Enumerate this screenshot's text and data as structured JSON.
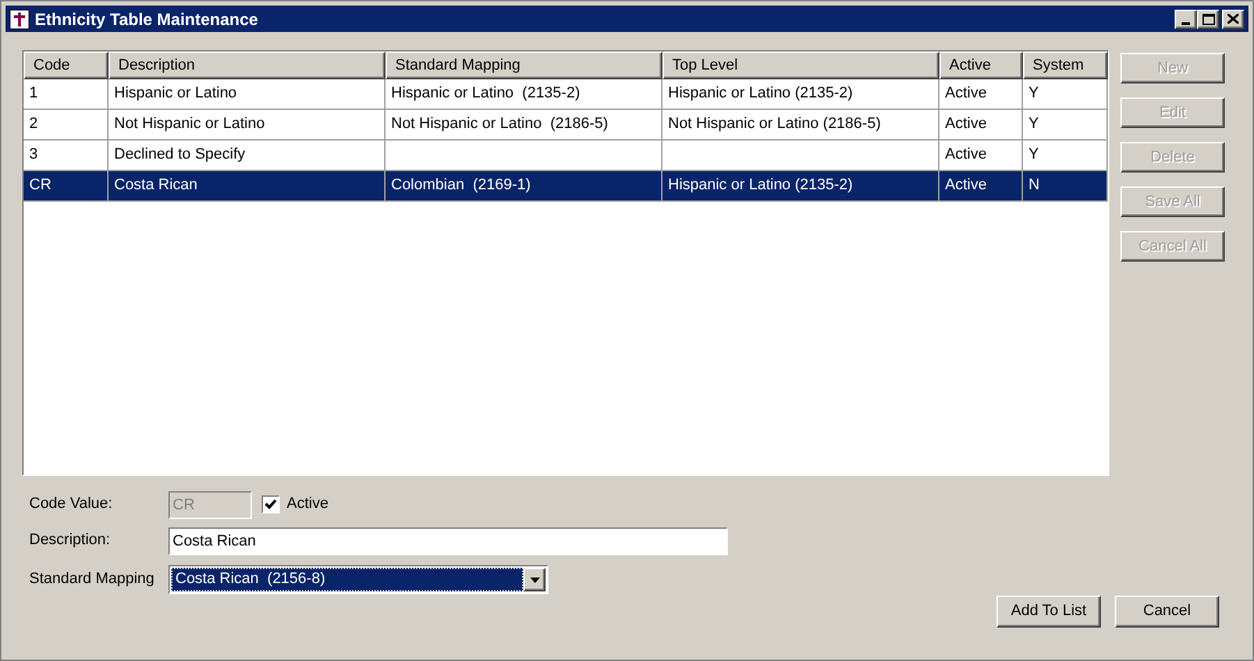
{
  "window": {
    "title": "Ethnicity Table Maintenance"
  },
  "table": {
    "columns": [
      "Code",
      "Description",
      "Standard Mapping",
      "Top Level",
      "Active",
      "System"
    ],
    "rows": [
      {
        "cells": [
          "1",
          "Hispanic or Latino",
          "Hispanic or Latino  (2135-2)",
          "Hispanic or Latino (2135-2)",
          "Active",
          "Y"
        ],
        "selected": false
      },
      {
        "cells": [
          "2",
          "Not Hispanic or Latino",
          "Not Hispanic or Latino  (2186-5)",
          "Not Hispanic or Latino (2186-5)",
          "Active",
          "Y"
        ],
        "selected": false
      },
      {
        "cells": [
          "3",
          "Declined to Specify",
          "",
          "",
          "Active",
          "Y"
        ],
        "selected": false
      },
      {
        "cells": [
          "CR",
          "Costa Rican",
          "Colombian  (2169-1)",
          "Hispanic or Latino (2135-2)",
          "Active",
          "N"
        ],
        "selected": true
      }
    ]
  },
  "side_buttons": [
    {
      "label": "New",
      "disabled": true
    },
    {
      "label": "Edit",
      "disabled": true
    },
    {
      "label": "Delete",
      "disabled": true
    },
    {
      "label": "Save All",
      "disabled": true
    },
    {
      "label": "Cancel All",
      "disabled": true
    }
  ],
  "form": {
    "code_value": {
      "label": "Code Value:",
      "value": "CR",
      "disabled": true
    },
    "active": {
      "label": "Active",
      "checked": true
    },
    "description": {
      "label": "Description:",
      "value": "Costa Rican"
    },
    "standard_mapping": {
      "label": "Standard Mapping",
      "value": "Costa Rican  (2156-8)"
    }
  },
  "footer_buttons": [
    {
      "label": "Add To List",
      "disabled": false
    },
    {
      "label": "Cancel",
      "disabled": false
    }
  ]
}
